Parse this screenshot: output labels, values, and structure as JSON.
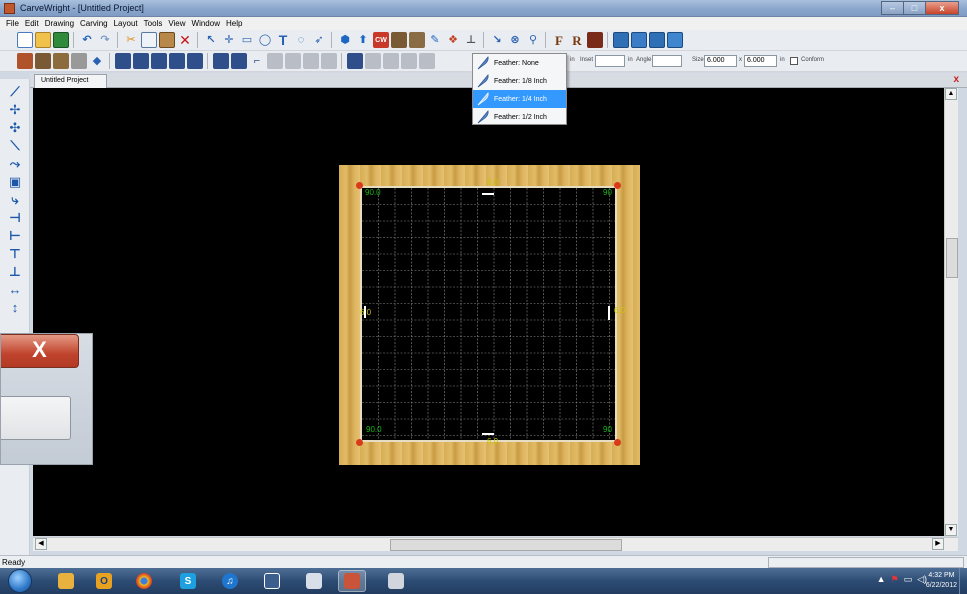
{
  "window": {
    "title": "CarveWright - [Untitled Project]",
    "close_glyph": "x"
  },
  "menubar": [
    "File",
    "Edit",
    "Drawing",
    "Carving",
    "Layout",
    "Tools",
    "View",
    "Window",
    "Help"
  ],
  "toolbar2": {
    "in_label_1": "in",
    "inset_label": "Inset",
    "in_label_2": "in",
    "angle_label": "Angle",
    "size_label": "Size",
    "size_x": "6.000",
    "x_label": "x",
    "size_y": "6.000",
    "in_label_3": "in",
    "conform_label": "Conform"
  },
  "feather_menu": {
    "items": [
      "Feather: None",
      "Feather: 1/8 Inch",
      "Feather: 1/4 Inch",
      "Feather: 1/2 Inch"
    ],
    "selected_index": 2
  },
  "document": {
    "tab_label": "Untitled Project",
    "close_glyph": "x"
  },
  "board": {
    "top_dim": "6.0",
    "right_dim": "6.0",
    "left_dim": "6.0",
    "bottom_dim": "6.0",
    "angle_tl": "90.0",
    "angle_tr": "90",
    "angle_bl": "90.0",
    "angle_br": "90"
  },
  "dialog": {
    "close_glyph": "X"
  },
  "statusbar": {
    "text": "Ready"
  },
  "taskbar": {
    "time": "4:32 PM",
    "date": "6/22/2012"
  },
  "colors": {
    "canvas": "#000000",
    "wood": "#d7ad55",
    "grid_line": "#8a8a8a",
    "corner": "#d93b1a",
    "dimension": "#c8c800",
    "angle": "#17b817",
    "selection": "#3399ff"
  }
}
